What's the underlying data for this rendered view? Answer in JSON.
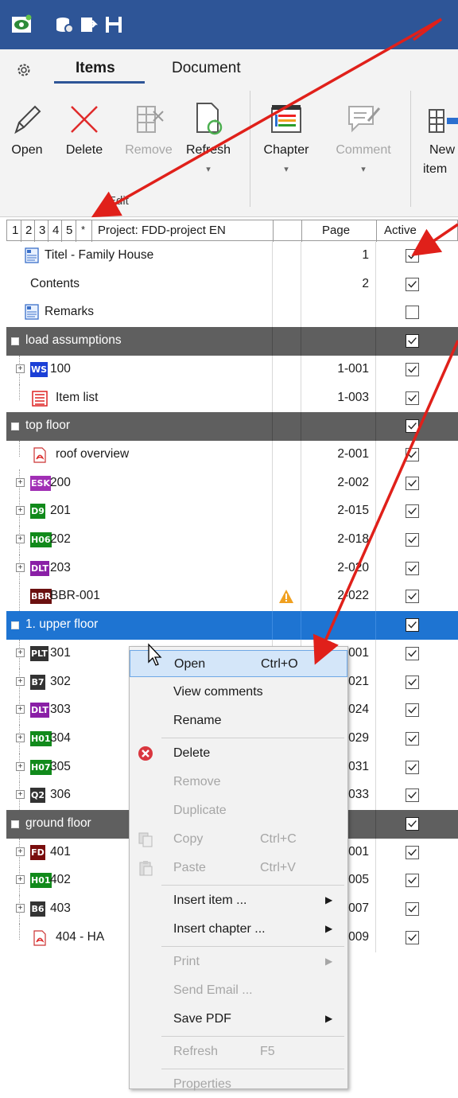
{
  "quick_access": [
    "app-icon",
    "settings-db-icon",
    "export-icon",
    "save-icon"
  ],
  "tabs": {
    "items": "Items",
    "document": "Document"
  },
  "ribbon": {
    "open": "Open",
    "delete": "Delete",
    "remove": "Remove",
    "refresh": "Refresh",
    "chapter": "Chapter",
    "comment": "Comment",
    "new_item_1": "New",
    "new_item_2": "item",
    "group_edit": "Edit"
  },
  "grid": {
    "levels": [
      "1",
      "2",
      "3",
      "4",
      "5",
      "*"
    ],
    "project": "Project: FDD-project EN",
    "col_page": "Page",
    "col_active": "Active",
    "rows": [
      {
        "label": "Titel - Family House",
        "page": "1",
        "checked": true,
        "kind": "doc"
      },
      {
        "label": "Contents",
        "page": "2",
        "checked": true,
        "kind": "plain"
      },
      {
        "label": "Remarks",
        "page": "",
        "checked": false,
        "kind": "doc"
      },
      {
        "label": "load assumptions",
        "page": "",
        "checked": true,
        "kind": "group"
      },
      {
        "label": "100",
        "badge": "WS",
        "badge_color": "#1b3fd6",
        "page": "1-001",
        "checked": true,
        "kind": "item",
        "expand": true
      },
      {
        "label": "Item list",
        "page": "1-003",
        "checked": true,
        "kind": "list"
      },
      {
        "label": "top floor",
        "page": "",
        "checked": true,
        "kind": "group"
      },
      {
        "label": "roof overview",
        "page": "2-001",
        "checked": true,
        "kind": "pdf"
      },
      {
        "label": "200",
        "badge": "ESK",
        "badge_color": "#a12fb5",
        "page": "2-002",
        "checked": true,
        "kind": "item",
        "expand": true
      },
      {
        "label": "201",
        "badge": "D9",
        "badge_color": "#118a1b",
        "page": "2-015",
        "checked": true,
        "kind": "item",
        "expand": true
      },
      {
        "label": "202",
        "badge": "H06",
        "badge_color": "#118a1b",
        "page": "2-018",
        "checked": true,
        "kind": "item",
        "expand": true
      },
      {
        "label": "203",
        "badge": "DLT",
        "badge_color": "#8a1fa6",
        "page": "2-020",
        "checked": true,
        "kind": "item",
        "expand": true
      },
      {
        "label": "BBR-001",
        "badge": "BBR",
        "badge_color": "#6b1010",
        "page": "2-022",
        "checked": true,
        "kind": "item",
        "expand": false,
        "warn": true
      },
      {
        "label": "1. upper floor",
        "page": "",
        "checked": true,
        "kind": "selected"
      },
      {
        "label": "301",
        "badge": "PLT",
        "badge_color": "#333333",
        "page": "3-001",
        "checked": true,
        "kind": "item",
        "expand": true
      },
      {
        "label": "302",
        "badge": "B7",
        "badge_color": "#333333",
        "page": "3-021",
        "checked": true,
        "kind": "item",
        "expand": true
      },
      {
        "label": "303",
        "badge": "DLT",
        "badge_color": "#8a1fa6",
        "page": "3-024",
        "checked": true,
        "kind": "item",
        "expand": true
      },
      {
        "label": "304",
        "badge": "H01",
        "badge_color": "#118a1b",
        "page": "3-029",
        "checked": true,
        "kind": "item",
        "expand": true
      },
      {
        "label": "305",
        "badge": "H07",
        "badge_color": "#118a1b",
        "page": "3-031",
        "checked": true,
        "kind": "item",
        "expand": true
      },
      {
        "label": "306",
        "badge": "Q2",
        "badge_color": "#333333",
        "page": "3-033",
        "checked": true,
        "kind": "item",
        "expand": true
      },
      {
        "label": "ground floor",
        "page": "",
        "checked": true,
        "kind": "group"
      },
      {
        "label": "401",
        "badge": "FD",
        "badge_color": "#7a0d0d",
        "page": "4-001",
        "checked": true,
        "kind": "item",
        "expand": true
      },
      {
        "label": "402",
        "badge": "H01",
        "badge_color": "#118a1b",
        "page": "4-005",
        "checked": true,
        "kind": "item",
        "expand": true
      },
      {
        "label": "403",
        "badge": "B6",
        "badge_color": "#333333",
        "page": "4-007",
        "checked": true,
        "kind": "item",
        "expand": true
      },
      {
        "label": "404 - HA",
        "page": "4-009",
        "checked": true,
        "kind": "pdf"
      }
    ]
  },
  "context_menu": {
    "items": [
      {
        "label": "Open",
        "shortcut": "Ctrl+O",
        "highlight": true
      },
      {
        "label": "View comments"
      },
      {
        "label": "Rename"
      },
      {
        "label": "Delete",
        "icon": "delete-icon",
        "sep_before": true
      },
      {
        "label": "Remove",
        "disabled": true
      },
      {
        "label": "Duplicate",
        "disabled": true
      },
      {
        "label": "Copy",
        "shortcut": "Ctrl+C",
        "disabled": true,
        "icon": "copy-icon"
      },
      {
        "label": "Paste",
        "shortcut": "Ctrl+V",
        "disabled": true,
        "icon": "paste-icon"
      },
      {
        "label": "Insert item ...",
        "submenu": true,
        "sep_before": true
      },
      {
        "label": "Insert chapter ...",
        "submenu": true
      },
      {
        "label": "Print",
        "submenu": true,
        "disabled": true,
        "sep_before": true
      },
      {
        "label": "Send Email ...",
        "disabled": true
      },
      {
        "label": "Save PDF",
        "submenu": true
      },
      {
        "label": "Refresh",
        "shortcut": "F5",
        "disabled": true,
        "sep_before": true
      },
      {
        "label": "Properties",
        "disabled": true,
        "sep_before": true
      }
    ]
  },
  "colors": {
    "titlebar": "#2e5597",
    "group_row": "#5f5f5f",
    "selected_row": "#1e74d2",
    "arrow": "#e0201a"
  }
}
